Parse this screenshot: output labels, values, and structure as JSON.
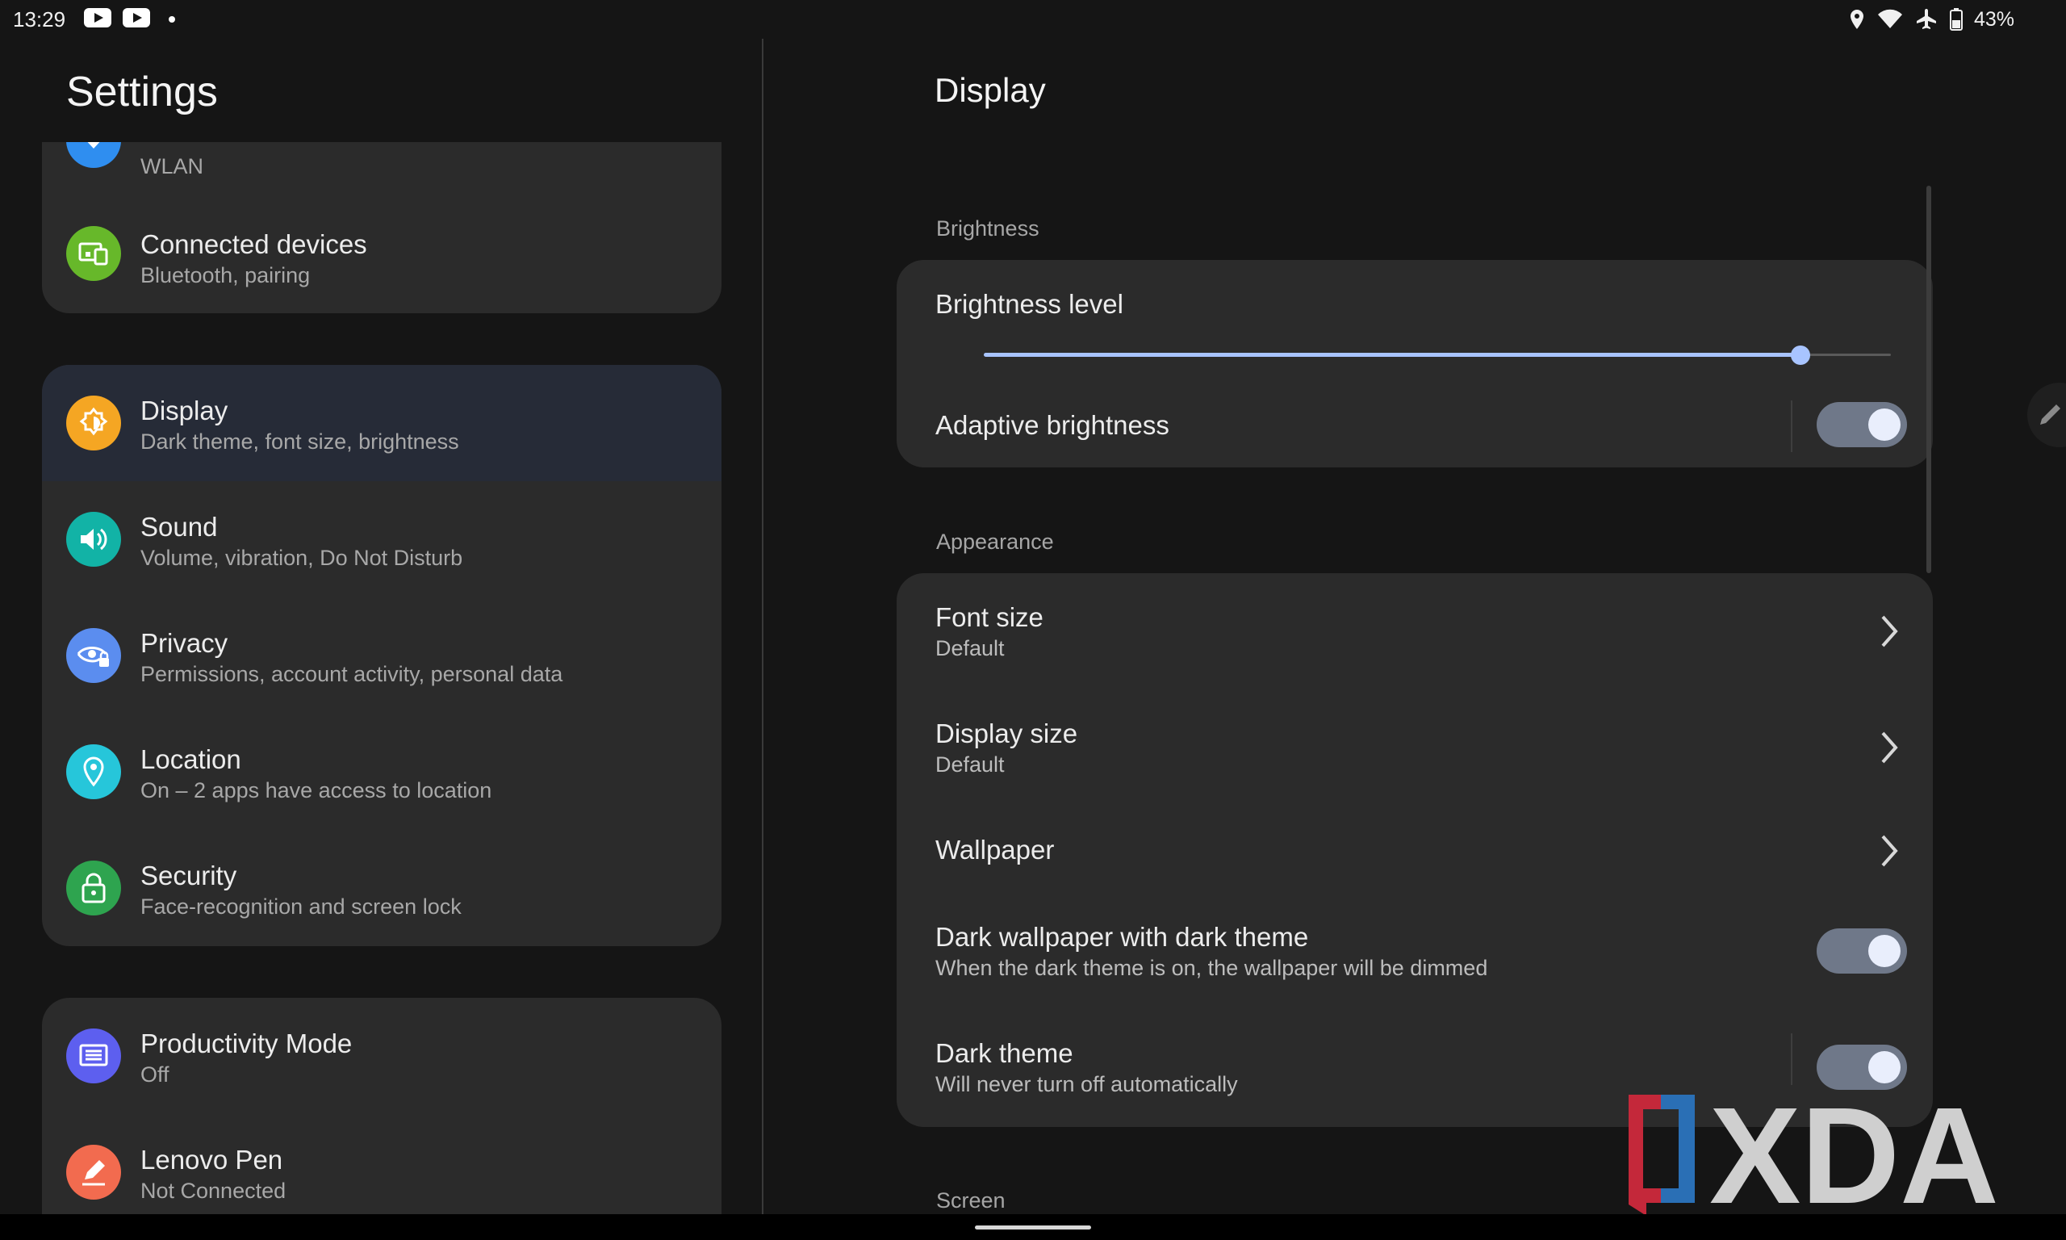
{
  "status_bar": {
    "time": "13:29",
    "battery": "43%"
  },
  "left_panel": {
    "title": "Settings",
    "card1": [
      {
        "title": "",
        "subtitle": "WLAN"
      },
      {
        "title": "Connected devices",
        "subtitle": "Bluetooth, pairing"
      }
    ],
    "card2": [
      {
        "title": "Display",
        "subtitle": "Dark theme, font size, brightness"
      },
      {
        "title": "Sound",
        "subtitle": "Volume, vibration, Do Not Disturb"
      },
      {
        "title": "Privacy",
        "subtitle": "Permissions, account activity, personal data"
      },
      {
        "title": "Location",
        "subtitle": "On – 2 apps have access to location"
      },
      {
        "title": "Security",
        "subtitle": "Face-recognition and screen lock"
      }
    ],
    "card3": [
      {
        "title": "Productivity Mode",
        "subtitle": "Off"
      },
      {
        "title": "Lenovo Pen",
        "subtitle": "Not Connected"
      }
    ]
  },
  "right_panel": {
    "title": "Display",
    "sections": {
      "brightness": "Brightness",
      "appearance": "Appearance",
      "screen": "Screen"
    },
    "brightness_level": {
      "title": "Brightness level",
      "value_percent": 90
    },
    "adaptive_brightness": {
      "title": "Adaptive brightness",
      "on": true
    },
    "font_size": {
      "title": "Font size",
      "subtitle": "Default"
    },
    "display_size": {
      "title": "Display size",
      "subtitle": "Default"
    },
    "wallpaper": {
      "title": "Wallpaper"
    },
    "dark_wallpaper": {
      "title": "Dark wallpaper with dark theme",
      "subtitle": "When the dark theme is on, the wallpaper will be dimmed",
      "on": true
    },
    "dark_theme": {
      "title": "Dark theme",
      "subtitle": "Will never turn off automatically",
      "on": true
    }
  },
  "watermark": "XDA",
  "colors": {
    "accent": "#a8c4ff",
    "toggle_track": "#6f7889",
    "wlan_icon": "#2f8ef0",
    "connected_icon": "#67b82a",
    "display_icon": "#f5a623",
    "sound_icon": "#12b3a6",
    "privacy_icon": "#5b8def",
    "location_icon": "#26c6da",
    "security_icon": "#2ea44f",
    "productivity_icon": "#5d5fef",
    "pen_icon": "#f26b4f"
  }
}
